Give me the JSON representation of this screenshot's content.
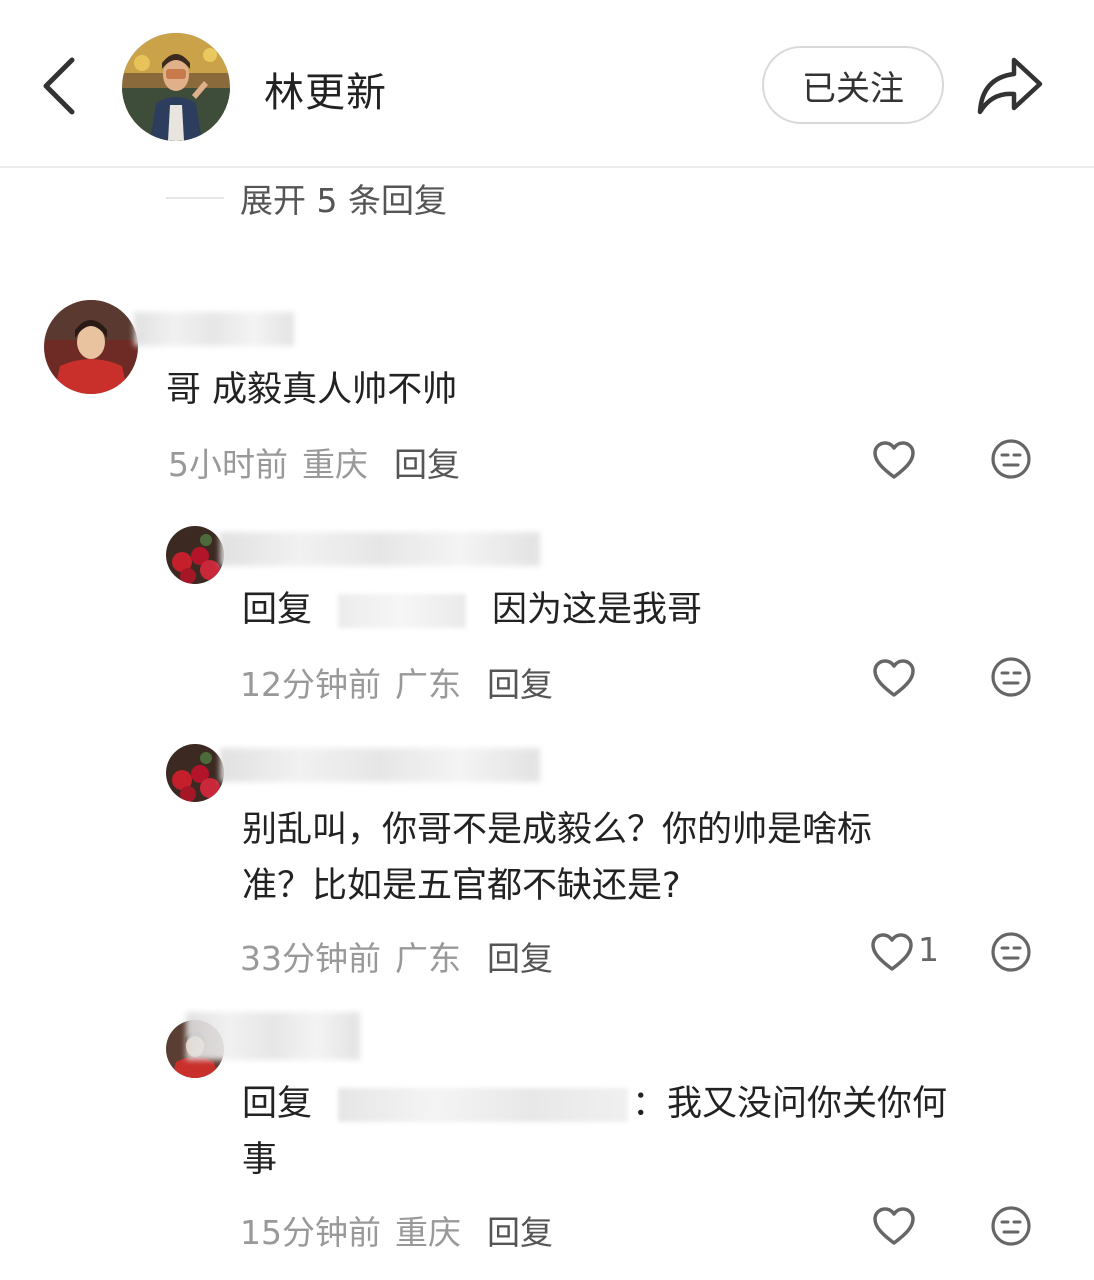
{
  "header": {
    "name": "林更新",
    "follow_label": "已关注"
  },
  "expand": {
    "label": "展开 5 条回复"
  },
  "comments": [
    {
      "text": "哥  成毅真人帅不帅",
      "time": "5小时前",
      "location": "重庆",
      "reply_label": "回复"
    },
    {
      "prefix": "回复",
      "text": "因为这是我哥",
      "time": "12分钟前",
      "location": "广东",
      "reply_label": "回复"
    },
    {
      "line1": "别乱叫，你哥不是成毅么？你的帅是啥标",
      "line2": "准？比如是五官都不缺还是?",
      "time": "33分钟前",
      "location": "广东",
      "reply_label": "回复",
      "likes": "1"
    },
    {
      "prefix": "回复",
      "line1_tail": "：我又没问你关你何",
      "line2": "事",
      "time": "15分钟前",
      "location": "重庆",
      "reply_label": "回复"
    }
  ],
  "icons": {
    "back": "chevron-left-icon",
    "share": "share-arrow-icon",
    "like": "heart-outline-icon",
    "emoji": "neutral-face-icon"
  }
}
